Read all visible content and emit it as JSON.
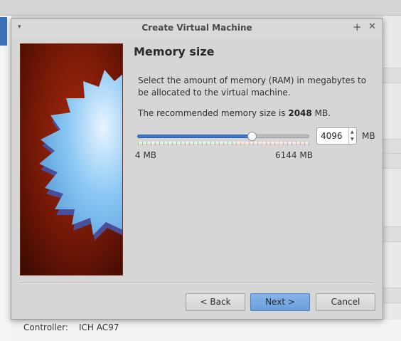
{
  "dialog": {
    "title": "Create Virtual Machine",
    "menu_glyph": "▾",
    "maximize_glyph": "+",
    "close_glyph": "✕"
  },
  "page": {
    "heading": "Memory size",
    "description": "Select the amount of memory (RAM) in megabytes to be allocated to the virtual machine.",
    "recommend_prefix": "The recommended memory size is ",
    "recommend_value": "2048",
    "recommend_suffix": " MB."
  },
  "memory": {
    "value": "4096",
    "value_mb": 4096,
    "min_mb": 4,
    "max_mb": 6144,
    "unit": "MB",
    "min_label": "4 MB",
    "max_label": "6144 MB",
    "colors": {
      "safe": "#7dcf7a",
      "warn": "#e8a98a",
      "danger": "#e59a9a",
      "accent": "#3c76c5"
    }
  },
  "buttons": {
    "back": "< Back",
    "next": "Next >",
    "cancel": "Cancel"
  },
  "background": {
    "controller_label": "Controller:",
    "controller_value": "ICH AC97"
  }
}
